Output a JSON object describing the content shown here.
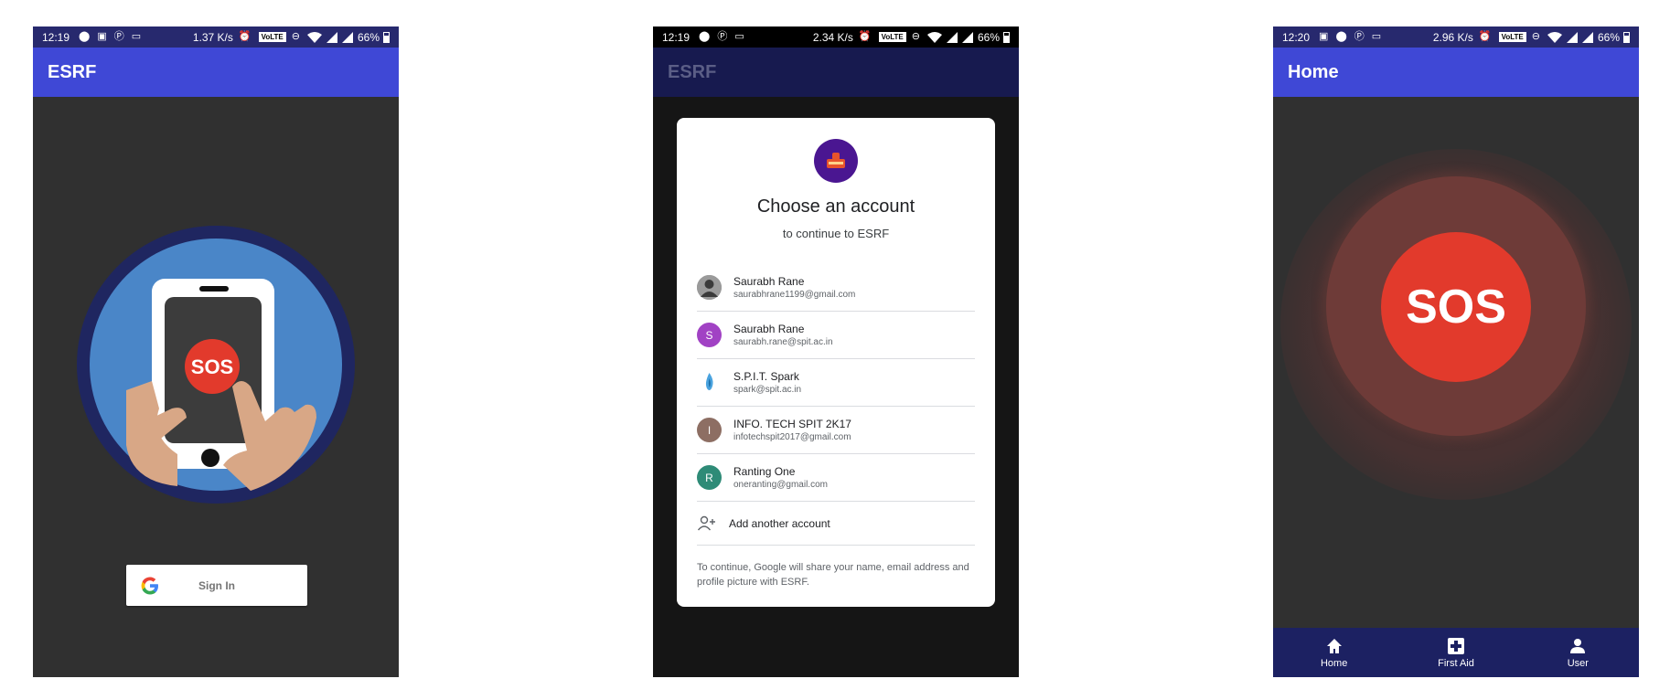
{
  "screens": [
    {
      "status": {
        "time": "12:19",
        "speed": "1.37 K/s",
        "battery": "66%",
        "volte": "VoLTE"
      },
      "appbar_title": "ESRF",
      "sos_label": "SOS",
      "signin_label": "Sign In"
    },
    {
      "status": {
        "time": "12:19",
        "speed": "2.34 K/s",
        "battery": "66%",
        "volte": "VoLTE"
      },
      "appbar_title": "ESRF",
      "chooser": {
        "title": "Choose an account",
        "subtitle": "to continue to ESRF",
        "accounts": [
          {
            "name": "Saurabh Rane",
            "email": "saurabhrane1199@gmail.com",
            "initial": ""
          },
          {
            "name": "Saurabh Rane",
            "email": "saurabh.rane@spit.ac.in",
            "initial": "S"
          },
          {
            "name": "S.P.I.T. Spark",
            "email": "spark@spit.ac.in",
            "initial": ""
          },
          {
            "name": "INFO. TECH SPIT 2K17",
            "email": "infotechspit2017@gmail.com",
            "initial": "I"
          },
          {
            "name": "Ranting One",
            "email": "oneranting@gmail.com",
            "initial": "R"
          }
        ],
        "add_account": "Add another account",
        "disclaimer": "To continue, Google will share your name, email address and profile picture with ESRF."
      }
    },
    {
      "status": {
        "time": "12:20",
        "speed": "2.96 K/s",
        "battery": "66%",
        "volte": "VoLTE"
      },
      "appbar_title": "Home",
      "sos_label": "SOS",
      "nav": [
        {
          "label": "Home",
          "icon": "home-icon"
        },
        {
          "label": "First Aid",
          "icon": "first-aid-icon"
        },
        {
          "label": "User",
          "icon": "user-icon"
        }
      ]
    }
  ],
  "colors": {
    "primary": "#3f48d6",
    "primary_dark": "#27296e",
    "sos_red": "#e23a2c",
    "background": "#303030"
  }
}
